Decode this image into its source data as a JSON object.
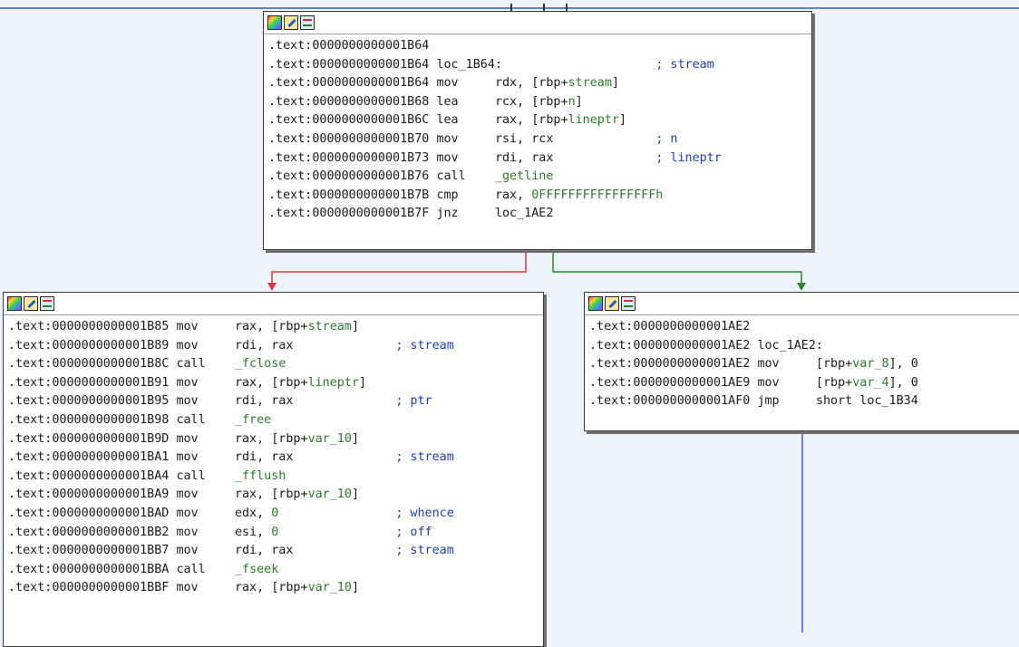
{
  "node_top": {
    "lines": [
      {
        "addr": ".text:0000000000001B64",
        "mn": "",
        "op": "",
        "cmt": ""
      },
      {
        "addr": ".text:0000000000001B64",
        "label": "loc_1B64:",
        "cmt": "; stream"
      },
      {
        "addr": ".text:0000000000001B64",
        "mn": "mov",
        "op_pre": "rdx, [rbp+",
        "sym": "stream",
        "op_post": "]",
        "cmt": ""
      },
      {
        "addr": ".text:0000000000001B68",
        "mn": "lea",
        "op_pre": "rcx, [rbp+",
        "sym": "n",
        "op_post": "]",
        "cmt": ""
      },
      {
        "addr": ".text:0000000000001B6C",
        "mn": "lea",
        "op_pre": "rax, [rbp+",
        "sym": "lineptr",
        "op_post": "]",
        "cmt": ""
      },
      {
        "addr": ".text:0000000000001B70",
        "mn": "mov",
        "op_pre": "rsi, rcx",
        "sym": "",
        "op_post": "",
        "cmt": "; n"
      },
      {
        "addr": ".text:0000000000001B73",
        "mn": "mov",
        "op_pre": "rdi, rax",
        "sym": "",
        "op_post": "",
        "cmt": "; lineptr"
      },
      {
        "addr": ".text:0000000000001B76",
        "mn": "call",
        "op_pre": "",
        "sym": "_getline",
        "op_post": "",
        "cmt": ""
      },
      {
        "addr": ".text:0000000000001B7B",
        "mn": "cmp",
        "op_pre": "rax, ",
        "sym": "0FFFFFFFFFFFFFFFFh",
        "op_post": "",
        "cmt": ""
      },
      {
        "addr": ".text:0000000000001B7F",
        "mn": "jnz",
        "op_pre": "loc_1AE2",
        "sym": "",
        "op_post": "",
        "cmt": ""
      }
    ]
  },
  "node_left": {
    "lines": [
      {
        "addr": ".text:0000000000001B85",
        "mn": "mov",
        "op_pre": "rax, [rbp+",
        "sym": "stream",
        "op_post": "]",
        "cmt": ""
      },
      {
        "addr": ".text:0000000000001B89",
        "mn": "mov",
        "op_pre": "rdi, rax",
        "sym": "",
        "op_post": "",
        "cmt": "; stream"
      },
      {
        "addr": ".text:0000000000001B8C",
        "mn": "call",
        "op_pre": "",
        "sym": "_fclose",
        "op_post": "",
        "cmt": ""
      },
      {
        "addr": ".text:0000000000001B91",
        "mn": "mov",
        "op_pre": "rax, [rbp+",
        "sym": "lineptr",
        "op_post": "]",
        "cmt": ""
      },
      {
        "addr": ".text:0000000000001B95",
        "mn": "mov",
        "op_pre": "rdi, rax",
        "sym": "",
        "op_post": "",
        "cmt": "; ptr"
      },
      {
        "addr": ".text:0000000000001B98",
        "mn": "call",
        "op_pre": "",
        "sym": "_free",
        "op_post": "",
        "cmt": ""
      },
      {
        "addr": ".text:0000000000001B9D",
        "mn": "mov",
        "op_pre": "rax, [rbp+",
        "sym": "var_10",
        "op_post": "]",
        "cmt": ""
      },
      {
        "addr": ".text:0000000000001BA1",
        "mn": "mov",
        "op_pre": "rdi, rax",
        "sym": "",
        "op_post": "",
        "cmt": "; stream"
      },
      {
        "addr": ".text:0000000000001BA4",
        "mn": "call",
        "op_pre": "",
        "sym": "_fflush",
        "op_post": "",
        "cmt": ""
      },
      {
        "addr": ".text:0000000000001BA9",
        "mn": "mov",
        "op_pre": "rax, [rbp+",
        "sym": "var_10",
        "op_post": "]",
        "cmt": ""
      },
      {
        "addr": ".text:0000000000001BAD",
        "mn": "mov",
        "op_pre": "edx, ",
        "sym": "0",
        "op_post": "",
        "cmt": "; whence"
      },
      {
        "addr": ".text:0000000000001BB2",
        "mn": "mov",
        "op_pre": "esi, ",
        "sym": "0",
        "op_post": "",
        "cmt": "; off"
      },
      {
        "addr": ".text:0000000000001BB7",
        "mn": "mov",
        "op_pre": "rdi, rax",
        "sym": "",
        "op_post": "",
        "cmt": "; stream"
      },
      {
        "addr": ".text:0000000000001BBA",
        "mn": "call",
        "op_pre": "",
        "sym": "_fseek",
        "op_post": "",
        "cmt": ""
      },
      {
        "addr": ".text:0000000000001BBF",
        "mn": "mov",
        "op_pre": "rax, [rbp+",
        "sym": "var_10",
        "op_post": "]",
        "cmt": ""
      }
    ]
  },
  "node_right": {
    "lines": [
      {
        "addr": ".text:0000000000001AE2",
        "mn": "",
        "op": "",
        "cmt": ""
      },
      {
        "addr": ".text:0000000000001AE2",
        "label": "loc_1AE2:",
        "cmt": ""
      },
      {
        "addr": ".text:0000000000001AE2",
        "mn": "mov",
        "op_pre": "[rbp+",
        "sym": "var_8",
        "op_post": "], 0",
        "cmt": ""
      },
      {
        "addr": ".text:0000000000001AE9",
        "mn": "mov",
        "op_pre": "[rbp+",
        "sym": "var_4",
        "op_post": "], 0",
        "cmt": ""
      },
      {
        "addr": ".text:0000000000001AF0",
        "mn": "jmp",
        "op_pre": "short loc_1B34",
        "sym": "",
        "op_post": "",
        "cmt": ""
      }
    ]
  },
  "colors": {
    "edge_false": "#e0393b",
    "edge_true": "#2a8a2a",
    "edge_jump": "#6b7fe0",
    "topline": "#5b84c4"
  }
}
